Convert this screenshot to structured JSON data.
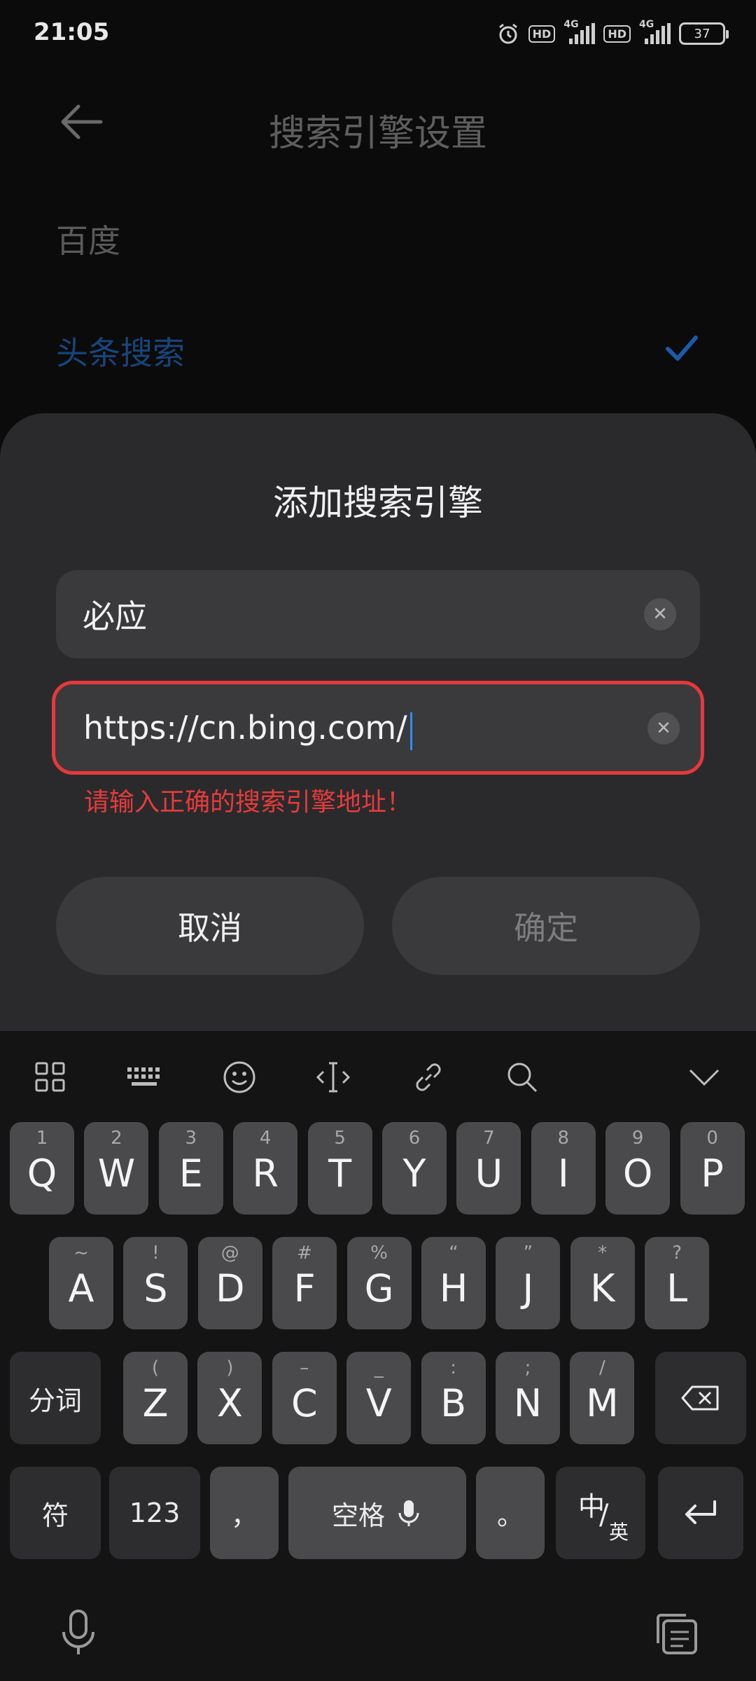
{
  "status_bar": {
    "time": "21:05",
    "hd1": "HD",
    "net1": "4G",
    "hd2": "HD",
    "net2": "4G",
    "battery": "37"
  },
  "background_page": {
    "title": "搜索引擎设置",
    "engines": [
      {
        "label": "百度",
        "selected": false
      },
      {
        "label": "头条搜索",
        "selected": true
      }
    ],
    "selected_color": "#1b5aa8"
  },
  "dialog": {
    "title": "添加搜索引擎",
    "name_field": {
      "value": "必应",
      "placeholder": ""
    },
    "url_field": {
      "value": "https://cn.bing.com/",
      "placeholder": ""
    },
    "error": "请输入正确的搜索引擎地址！",
    "cancel_label": "取消",
    "confirm_label": "确定",
    "error_color": "#e6383c"
  },
  "keyboard": {
    "toolbar_icons": [
      "apps-grid-icon",
      "keyboard-icon",
      "emoji-icon",
      "cursor-move-icon",
      "link-icon",
      "search-icon",
      "collapse-icon"
    ],
    "row1": [
      {
        "k": "Q",
        "s": "1"
      },
      {
        "k": "W",
        "s": "2"
      },
      {
        "k": "E",
        "s": "3"
      },
      {
        "k": "R",
        "s": "4"
      },
      {
        "k": "T",
        "s": "5"
      },
      {
        "k": "Y",
        "s": "6"
      },
      {
        "k": "U",
        "s": "7"
      },
      {
        "k": "I",
        "s": "8"
      },
      {
        "k": "O",
        "s": "9"
      },
      {
        "k": "P",
        "s": "0"
      }
    ],
    "row2": [
      {
        "k": "A",
        "s": "~"
      },
      {
        "k": "S",
        "s": "!"
      },
      {
        "k": "D",
        "s": "@"
      },
      {
        "k": "F",
        "s": "#"
      },
      {
        "k": "G",
        "s": "%"
      },
      {
        "k": "H",
        "s": "“"
      },
      {
        "k": "J",
        "s": "”"
      },
      {
        "k": "K",
        "s": "*"
      },
      {
        "k": "L",
        "s": "?"
      }
    ],
    "row3": [
      {
        "k": "Z",
        "s": "("
      },
      {
        "k": "X",
        "s": ")"
      },
      {
        "k": "C",
        "s": "–"
      },
      {
        "k": "V",
        "s": "_"
      },
      {
        "k": "B",
        "s": ":"
      },
      {
        "k": "N",
        "s": ";"
      },
      {
        "k": "M",
        "s": "/"
      }
    ],
    "fenci": "分词",
    "symbol": "符",
    "num": "123",
    "comma": "，",
    "space": "空格",
    "period": "。",
    "lang_cn": "中",
    "lang_en": "英"
  }
}
